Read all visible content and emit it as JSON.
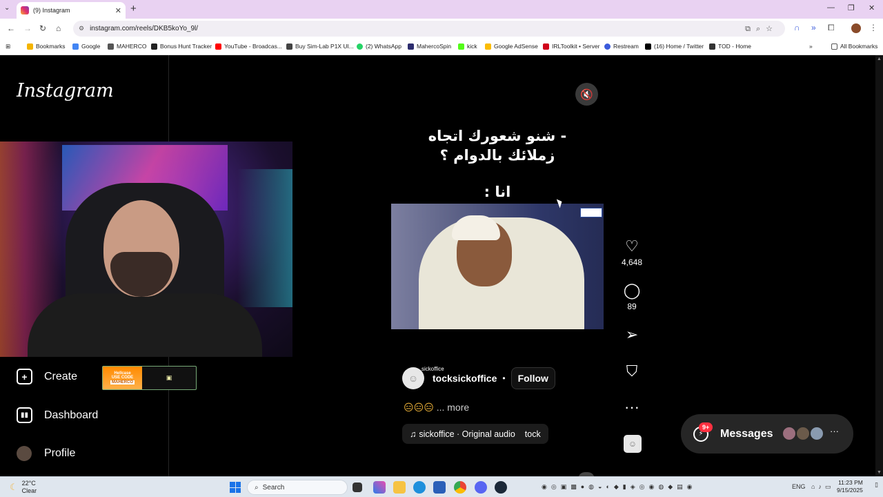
{
  "browser": {
    "tab_title": "(9) Instagram",
    "url": "instagram.com/reels/DKB5koYo_9l/",
    "bookmarks": [
      {
        "label": "Bookmarks",
        "color": "#f4b400"
      },
      {
        "label": "Google",
        "color": "#4285f4"
      },
      {
        "label": "MAHERCO",
        "color": "#555555"
      },
      {
        "label": "Bonus Hunt Tracker",
        "color": "#222222"
      },
      {
        "label": "YouTube - Broadcas...",
        "color": "#ff0000"
      },
      {
        "label": "Buy Sim-Lab P1X Ul...",
        "color": "#444444"
      },
      {
        "label": "(2) WhatsApp",
        "color": "#25d366"
      },
      {
        "label": "MahercoSpin",
        "color": "#2d2d6e"
      },
      {
        "label": "kick",
        "color": "#53fc18"
      },
      {
        "label": "Google AdSense",
        "color": "#fbbc04"
      },
      {
        "label": "IRLToolkit • Server",
        "color": "#d0021b"
      },
      {
        "label": "Restream",
        "color": "#3b5bdb"
      },
      {
        "label": "(16) Home / Twitter",
        "color": "#000000"
      },
      {
        "label": "TOD - Home",
        "color": "#333333"
      }
    ],
    "all_bookmarks": "All Bookmarks"
  },
  "instagram": {
    "logo": "Instagram",
    "sidebar": {
      "create": "Create",
      "dashboard": "Dashboard",
      "profile": "Profile"
    },
    "promo": {
      "brand": "Hellcase",
      "use_code": "USE CODE",
      "code": "MAHERCO"
    },
    "reel": {
      "caption_line1": "- شنو شعورك اتجاه",
      "caption_line2": "زملائك بالدوام ؟",
      "caption_line3": "انا :",
      "likes": "4,648",
      "comments": "89",
      "author_tag": "sickoffice",
      "author": "tocksickoffice",
      "follow": "Follow",
      "description_emojis": "😑😑😑",
      "more": "... more",
      "audio": "sickoffice · Original audio",
      "audio_extra": "tock"
    },
    "messages": {
      "label": "Messages",
      "badge": "9+"
    }
  },
  "taskbar": {
    "temp": "22°C",
    "weather": "Clear",
    "search": "Search",
    "lang": "ENG",
    "time": "11:23 PM",
    "date": "9/15/2025"
  }
}
